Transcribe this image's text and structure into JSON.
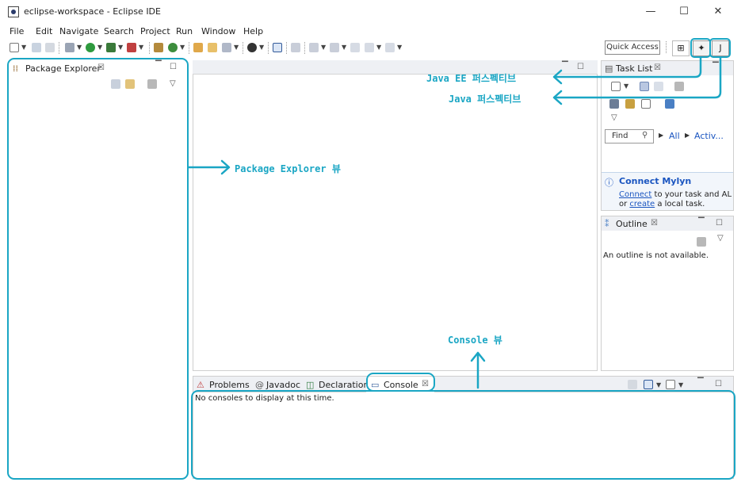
{
  "window": {
    "title": "eclipse-workspace - Eclipse IDE",
    "minimize": "—",
    "maximize": "☐",
    "close": "✕"
  },
  "menu": [
    "File",
    "Edit",
    "Navigate",
    "Search",
    "Project",
    "Run",
    "Window",
    "Help"
  ],
  "toolbar": {
    "quick_access": "Quick Access"
  },
  "package_explorer": {
    "tab_label": "Package Explorer",
    "tab_close": "☒"
  },
  "task_list": {
    "tab_label": "Task List",
    "tab_close": "☒",
    "find_placeholder": "Find",
    "filter_all": "All",
    "filter_active": "Activ...",
    "mylyn_title": "Connect Mylyn",
    "mylyn_link_connect": "Connect",
    "mylyn_text_1": " to your task and AL",
    "mylyn_text_or": "or ",
    "mylyn_link_create": "create",
    "mylyn_text_2": " a local task."
  },
  "outline": {
    "tab_label": "Outline",
    "tab_close": "☒",
    "message": "An outline is not available."
  },
  "bottom_panel": {
    "tabs": [
      "Problems",
      "Javadoc",
      "Declaration",
      "Console"
    ],
    "console_close": "☒",
    "console_message": "No consoles to display at this time."
  },
  "annotations": {
    "java_ee_perspective": "Java EE 퍼스펙티브",
    "java_perspective": "Java 퍼스펙티브",
    "package_explorer_view": "Package Explorer 뷰",
    "console_view": "Console 뷰"
  },
  "colors": {
    "annotation": "#1aa6c4",
    "link": "#1a55c0"
  }
}
